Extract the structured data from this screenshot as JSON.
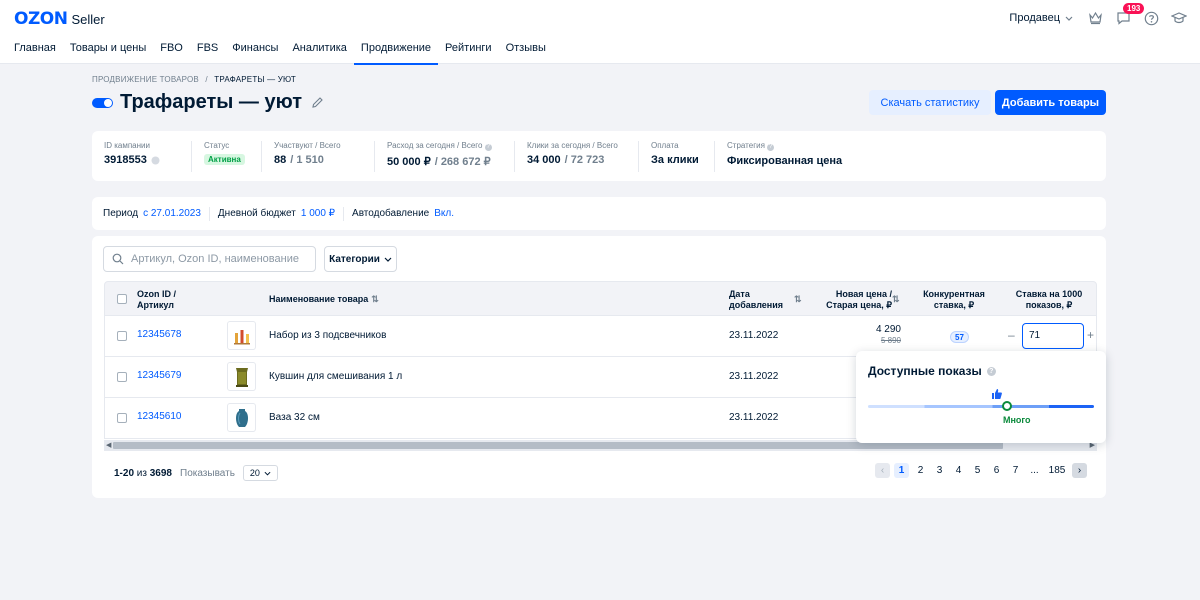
{
  "header": {
    "logo_brand": "OZON",
    "logo_product": "Seller",
    "seller_menu": "Продавец",
    "notifications_count": "193"
  },
  "nav": {
    "items": [
      {
        "label": "Главная"
      },
      {
        "label": "Товары и цены"
      },
      {
        "label": "FBO"
      },
      {
        "label": "FBS"
      },
      {
        "label": "Финансы"
      },
      {
        "label": "Аналитика"
      },
      {
        "label": "Продвижение",
        "active": true
      },
      {
        "label": "Рейтинги"
      },
      {
        "label": "Отзывы"
      }
    ]
  },
  "breadcrumb": {
    "parent": "ПРОДВИЖЕНИЕ ТОВАРОВ",
    "separator": "/",
    "current": "ТРАФАРЕТЫ — УЮТ"
  },
  "page": {
    "title": "Трафареты — уют",
    "download_stats_label": "Скачать статистику",
    "add_products_label": "Добавить товары"
  },
  "stats": {
    "campaign_id_label": "ID кампании",
    "campaign_id_value": "3918553",
    "status_label": "Статус",
    "status_value": "Активна",
    "participating_label": "Участвуют / Всего",
    "participating_value": "88",
    "participating_total": "/ 1 510",
    "spend_label": "Расход за сегодня / Всего",
    "spend_value": "50 000 ₽",
    "spend_total": "/ 268 672 ₽",
    "clicks_label": "Клики за сегодня / Всего",
    "clicks_value": "34 000",
    "clicks_total": "/ 72 723",
    "payment_label": "Оплата",
    "payment_value": "За клики",
    "strategy_label": "Стратегия",
    "strategy_value": "Фиксированная цена"
  },
  "period": {
    "period_label": "Период",
    "period_value": "с 27.01.2023",
    "budget_label": "Дневной бюджет",
    "budget_value": "1 000 ₽",
    "autoadd_label": "Автодобавление",
    "autoadd_value": "Вкл."
  },
  "toolbar": {
    "search_placeholder": "Артикул, Ozon ID, наименование",
    "categories_label": "Категории"
  },
  "table": {
    "columns": {
      "id": "Ozon ID /",
      "id2": "Артикул",
      "name": "Наименование товара",
      "date": "Дата",
      "date2": "добавления",
      "price": "Новая цена /",
      "price2": "Старая цена, ₽",
      "competitive": "Конкурентная",
      "competitive2": "ставка, ₽",
      "bid": "Ставка на 1000",
      "bid2": "показов, ₽"
    },
    "rows": [
      {
        "id": "12345678",
        "name": "Набор из 3 подсвечников",
        "date": "23.11.2022",
        "new_price": "4 290",
        "old_price": "5 890",
        "competitive": "57",
        "bid": "71"
      },
      {
        "id": "12345679",
        "name": "Кувшин для смешивания 1 л",
        "date": "23.11.2022"
      },
      {
        "id": "12345610",
        "name": "Ваза 32 см",
        "date": "23.11.2022"
      }
    ]
  },
  "footer": {
    "range": "1-20",
    "of_label": "из",
    "total": "3698",
    "show_label": "Показывать",
    "per_page": "20",
    "pages": [
      "1",
      "2",
      "3",
      "4",
      "5",
      "6",
      "7",
      "...",
      "185"
    ]
  },
  "popover": {
    "title": "Доступные показы",
    "level_label": "Много"
  },
  "colors": {
    "accent": "#005bff",
    "text": "#001a34",
    "muted": "#707f8d",
    "success": "#00a046",
    "danger": "#f91155"
  }
}
